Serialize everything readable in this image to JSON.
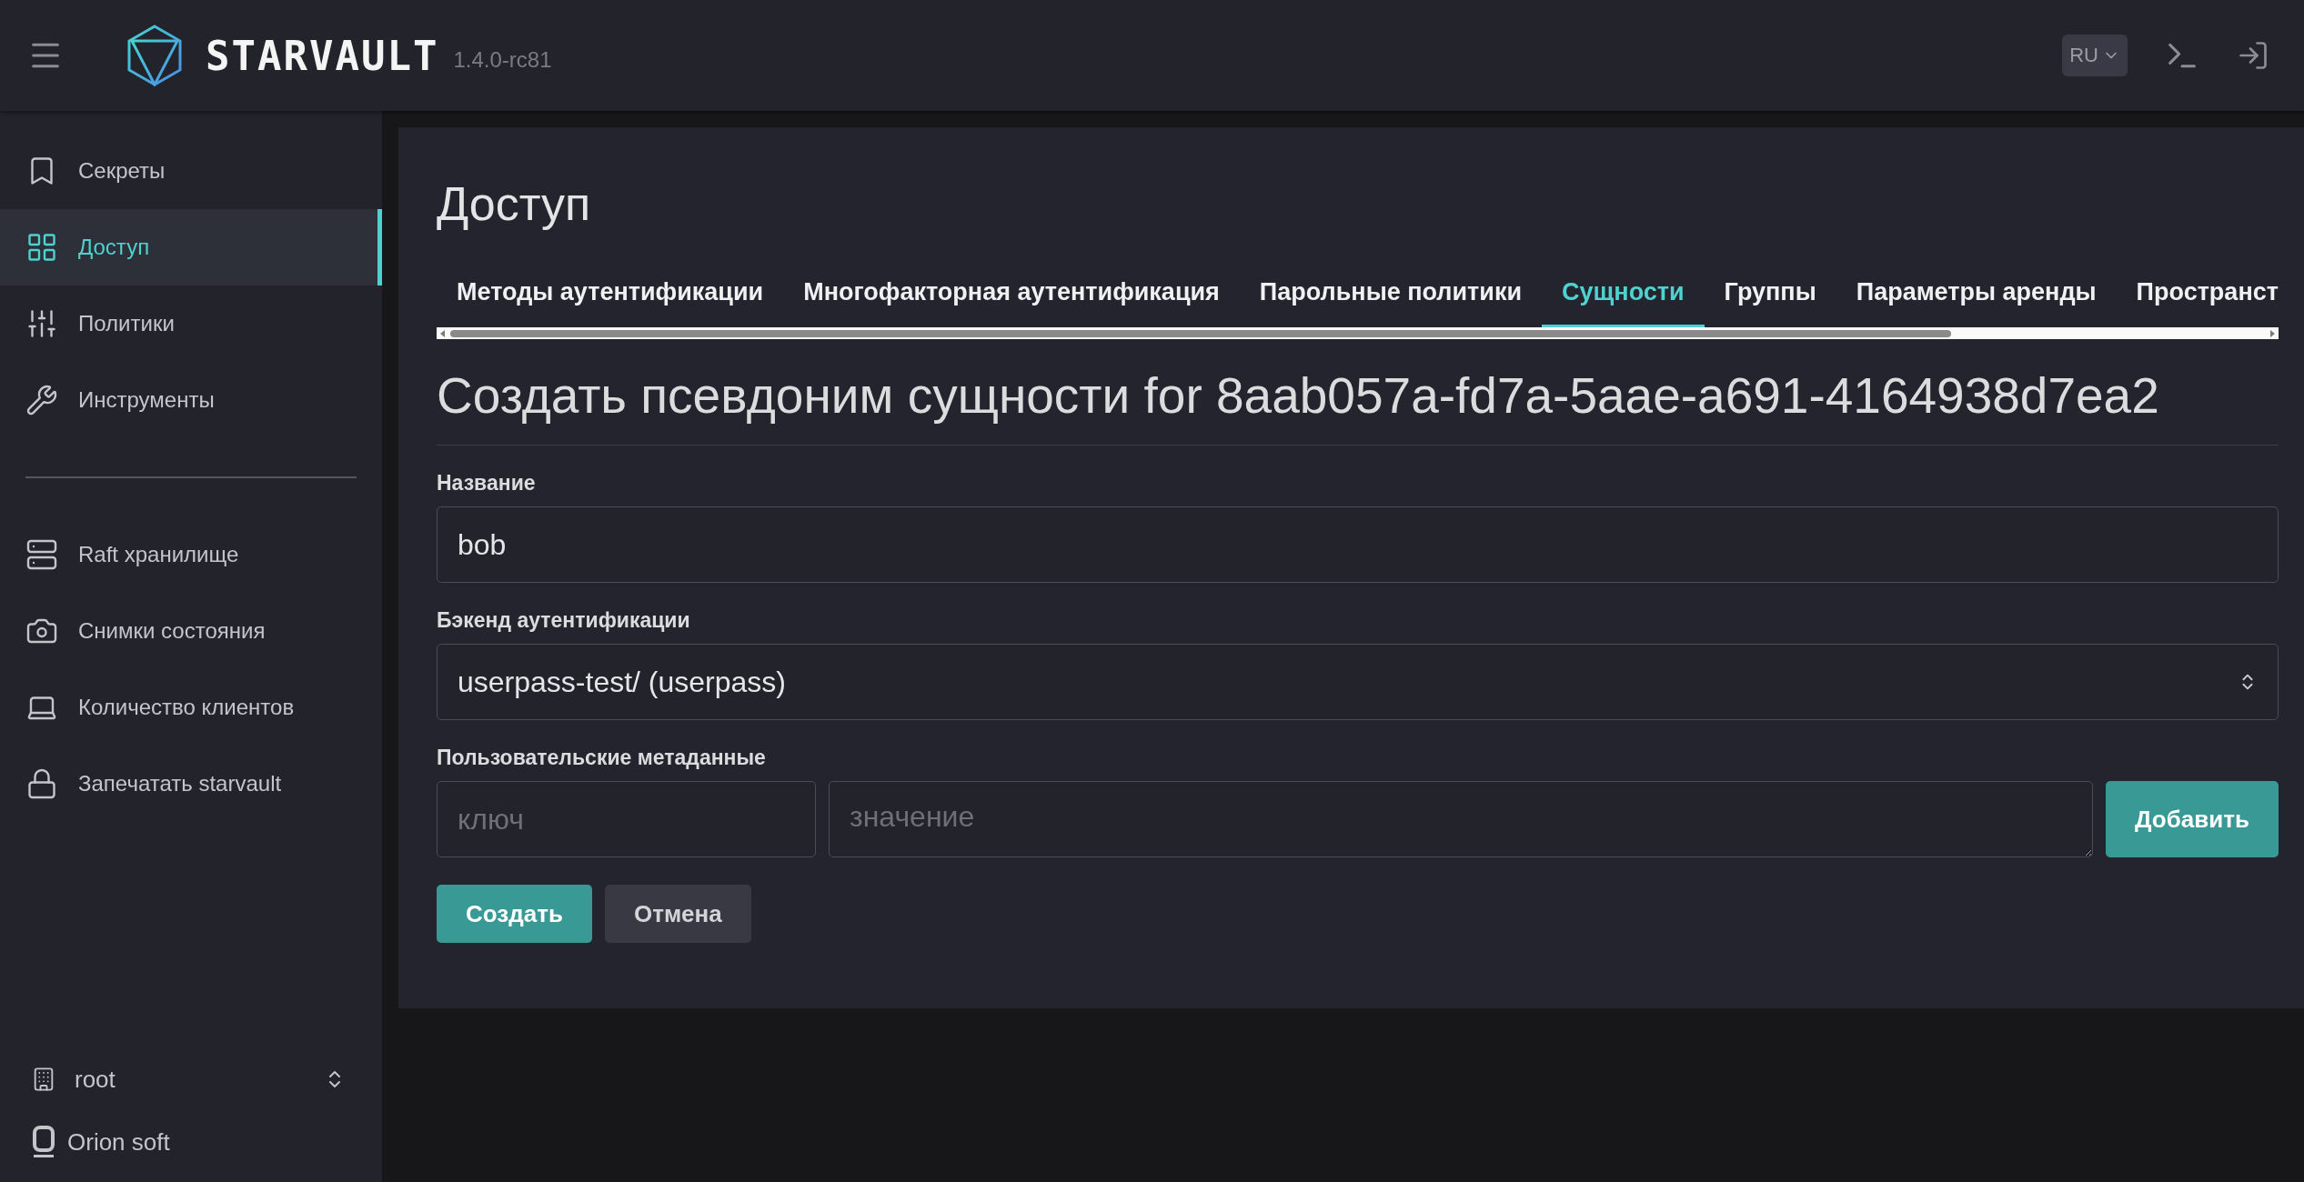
{
  "header": {
    "logo_text": "STARVAULT",
    "version": "1.4.0-rc81",
    "language": "RU"
  },
  "sidebar": {
    "items": [
      {
        "label": "Секреты",
        "selected": false
      },
      {
        "label": "Доступ",
        "selected": true
      },
      {
        "label": "Политики",
        "selected": false
      },
      {
        "label": "Инструменты",
        "selected": false
      }
    ],
    "tools": [
      {
        "label": "Raft хранилище",
        "selected": false
      },
      {
        "label": "Снимки состояния",
        "selected": false
      },
      {
        "label": "Количество клиентов",
        "selected": false
      },
      {
        "label": "Запечатать starvault",
        "selected": false
      }
    ],
    "namespace": "root",
    "footer": "Orion soft"
  },
  "page": {
    "title": "Доступ",
    "tabs": [
      {
        "label": "Методы аутентификации",
        "selected": false
      },
      {
        "label": "Многофакторная аутентификация",
        "selected": false
      },
      {
        "label": "Парольные политики",
        "selected": false
      },
      {
        "label": "Сущности",
        "selected": true
      },
      {
        "label": "Группы",
        "selected": false
      },
      {
        "label": "Параметры аренды",
        "selected": false
      },
      {
        "label": "Пространст",
        "selected": false
      }
    ],
    "form": {
      "heading": "Создать псевдоним сущности for 8aab057a-fd7a-5aae-a691-4164938d7ea2",
      "name": {
        "label": "Название",
        "value": "bob"
      },
      "backend": {
        "label": "Бэкенд аутентификации",
        "value": "userpass-test/ (userpass)"
      },
      "metadata": {
        "label": "Пользовательские метаданные",
        "key_placeholder": "ключ",
        "value_placeholder": "значение",
        "add_button": "Добавить"
      },
      "actions": [
        {
          "label": "Создать",
          "kind": "primary"
        },
        {
          "label": "Отмена",
          "kind": "secondary"
        }
      ]
    }
  }
}
